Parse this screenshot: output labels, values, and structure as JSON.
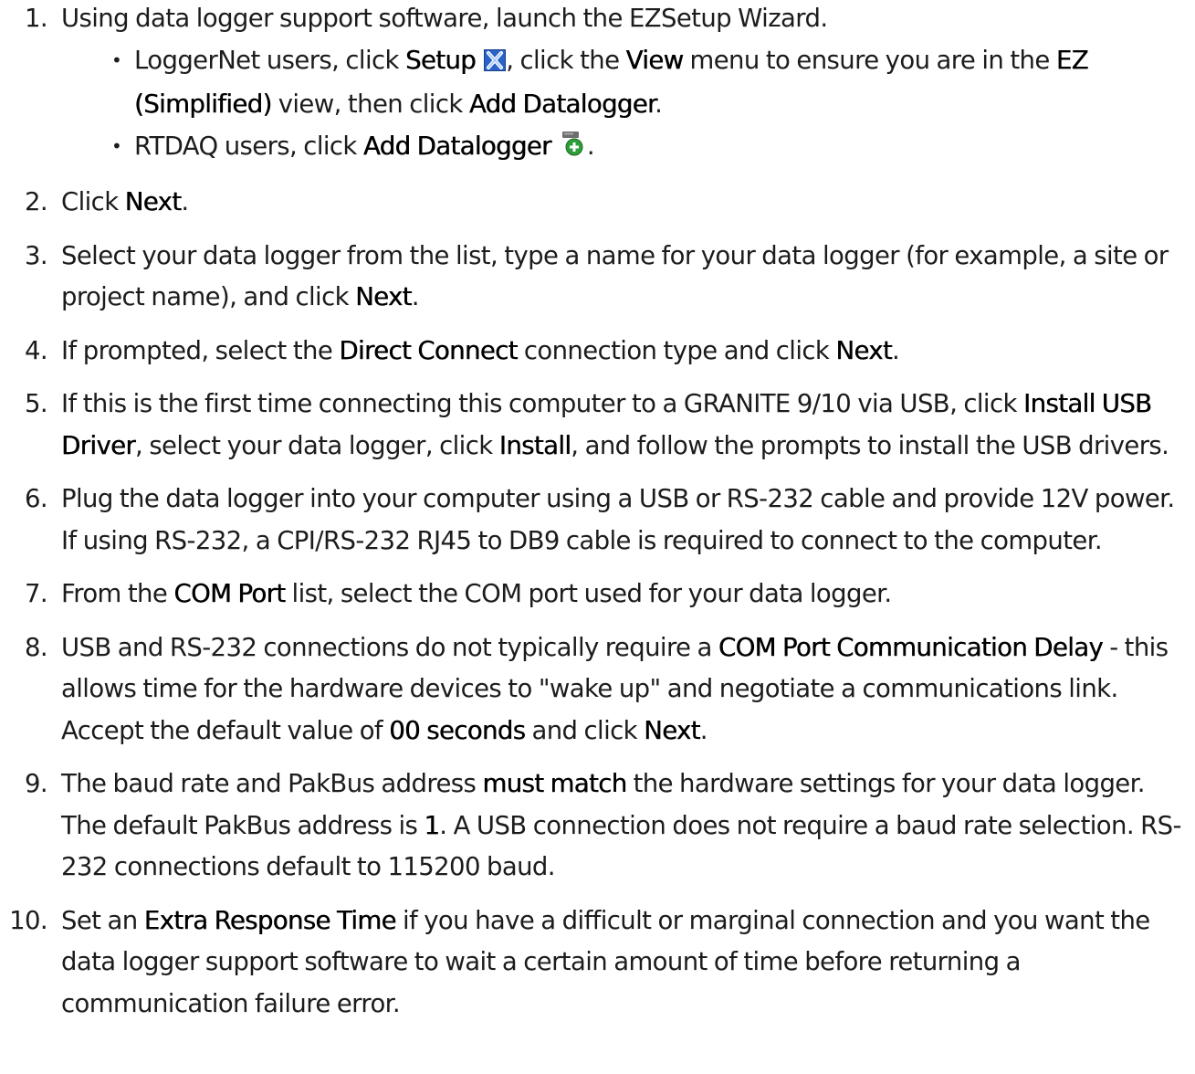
{
  "steps": [
    {
      "num": "1.",
      "text": "Using data logger support software, launch the EZSetup Wizard.",
      "bullets": [
        {
          "pre": "LoggerNet users, click ",
          "setup": "Setup",
          "icon": "setup-icon",
          "mid1": ", click the ",
          "view": "View",
          "mid2": " menu to ensure you are in the ",
          "ez": "EZ (Simplified)",
          "mid3": " view, then click ",
          "add": "Add Datalogger",
          "end": "."
        },
        {
          "pre": "RTDAQ users, click ",
          "add": "Add Datalogger",
          "icon": "add-datalogger-icon",
          "end": "."
        }
      ]
    },
    {
      "num": "2.",
      "pre": "Click ",
      "b1": "Next",
      "end": "."
    },
    {
      "num": "3.",
      "pre": "Select your data logger from the list, type a name for your data logger (for example, a site or project name), and click ",
      "b1": "Next",
      "end": "."
    },
    {
      "num": "4.",
      "pre": "If prompted, select the ",
      "b1": "Direct Connect",
      "mid": " connection type and click ",
      "b2": "Next",
      "end": "."
    },
    {
      "num": "5.",
      "pre": "If this is the first time connecting this computer to a GRANITE 9/10 via USB, click ",
      "b1": "Install USB Driver",
      "mid": ", select your data logger, click ",
      "b2": "Install",
      "end": ", and follow the prompts to install the USB drivers."
    },
    {
      "num": "6.",
      "text": "Plug the data logger into your computer using a USB or RS-232 cable and provide 12V power. If using RS-232, a CPI/RS-232 RJ45 to DB9 cable is required to connect to the computer."
    },
    {
      "num": "7.",
      "pre": "From the ",
      "b1": "COM Port",
      "end": " list, select the COM port used for your data logger."
    },
    {
      "num": "8.",
      "pre": "USB and RS-232 connections do not typically require a ",
      "b1": "COM Port Communication Delay",
      "mid": " - this allows time for the hardware devices to \"wake up\" and negotiate a communications link. Accept the default value of ",
      "b2": "00 seconds",
      "mid2": " and click ",
      "b3": "Next",
      "end": "."
    },
    {
      "num": "9.",
      "pre": "The baud rate and PakBus address ",
      "b1": "must match",
      "mid": " the hardware settings for your data logger. The default PakBus address is ",
      "b2": "1",
      "end": ". A USB connection does not require a baud rate selection. RS-232 connections default to 115200 baud."
    },
    {
      "num": "10.",
      "pre": "Set an ",
      "b1": "Extra Response Time",
      "end": " if you have a difficult or marginal connection and you want the data logger support software to wait a certain amount of time before returning a communication failure error."
    }
  ],
  "colors": {
    "text": "#1c1c1c",
    "setup_icon_bg": "#2a62c9",
    "add_icon_green": "#2e9e3a"
  }
}
